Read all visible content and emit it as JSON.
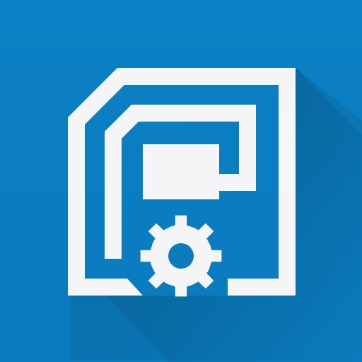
{
  "icon": {
    "name": "chip-gear-app-icon",
    "depicts": [
      "chip-outline-icon",
      "gear-icon"
    ],
    "colors": {
      "background": "#0a7bbd",
      "background_top": "#0b80c4",
      "foreground": "#f4f5f7",
      "long_shadow": "#06557f"
    }
  }
}
